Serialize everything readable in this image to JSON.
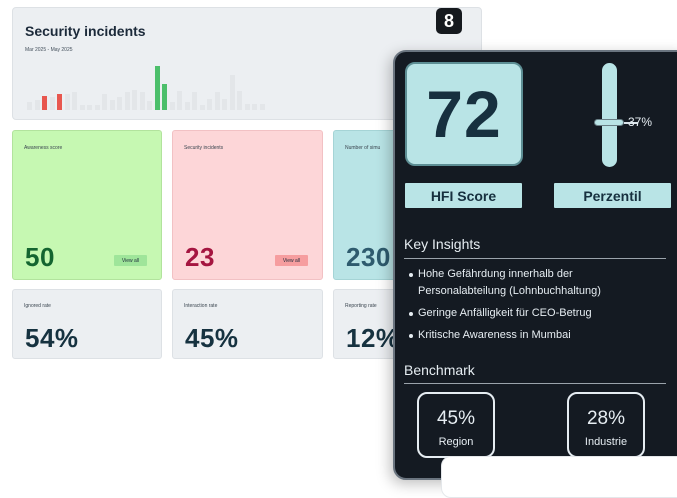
{
  "panel": {
    "title": "Security incidents",
    "range": "Mar 2025 - May 2025",
    "logo": "8",
    "bars": [
      {
        "v": 0.18,
        "c": "#e3e6e9"
      },
      {
        "v": 0.22,
        "c": "#e3e6e9"
      },
      {
        "v": 0.32,
        "c": "#e8574f"
      },
      {
        "v": 0.3,
        "c": "#e3e6e9"
      },
      {
        "v": 0.36,
        "c": "#e8574f"
      },
      {
        "v": 0.36,
        "c": "#e3e6e9"
      },
      {
        "v": 0.4,
        "c": "#e3e6e9"
      },
      {
        "v": 0.12,
        "c": "#e3e6e9"
      },
      {
        "v": 0.12,
        "c": "#e3e6e9"
      },
      {
        "v": 0.12,
        "c": "#e3e6e9"
      },
      {
        "v": 0.36,
        "c": "#e3e6e9"
      },
      {
        "v": 0.22,
        "c": "#e3e6e9"
      },
      {
        "v": 0.3,
        "c": "#e3e6e9"
      },
      {
        "v": 0.42,
        "c": "#e3e6e9"
      },
      {
        "v": 0.46,
        "c": "#e3e6e9"
      },
      {
        "v": 0.42,
        "c": "#e3e6e9"
      },
      {
        "v": 0.2,
        "c": "#e3e6e9"
      },
      {
        "v": 1.0,
        "c": "#4cbf6b"
      },
      {
        "v": 0.58,
        "c": "#4cbf6b"
      },
      {
        "v": 0.18,
        "c": "#e3e6e9"
      },
      {
        "v": 0.44,
        "c": "#e3e6e9"
      },
      {
        "v": 0.18,
        "c": "#e3e6e9"
      },
      {
        "v": 0.4,
        "c": "#e3e6e9"
      },
      {
        "v": 0.12,
        "c": "#e3e6e9"
      },
      {
        "v": 0.26,
        "c": "#e3e6e9"
      },
      {
        "v": 0.42,
        "c": "#e3e6e9"
      },
      {
        "v": 0.26,
        "c": "#e3e6e9"
      },
      {
        "v": 0.8,
        "c": "#e3e6e9"
      },
      {
        "v": 0.44,
        "c": "#e3e6e9"
      },
      {
        "v": 0.14,
        "c": "#e3e6e9"
      },
      {
        "v": 0.14,
        "c": "#e3e6e9"
      },
      {
        "v": 0.14,
        "c": "#e3e6e9"
      }
    ]
  },
  "cards": [
    {
      "label": "Awareness score",
      "value": "50",
      "button": "View all",
      "bg": "#c6f8b2",
      "border": "#b2e39d",
      "value_color": "#146530",
      "btn_bg": "#9fe59a"
    },
    {
      "label": "Security incidents",
      "value": "23",
      "button": "View all",
      "bg": "#fdd6d8",
      "border": "#f2c1c4",
      "value_color": "#a51540",
      "btn_bg": "#f69d9f"
    },
    {
      "label": "Number of simu",
      "value": "230",
      "bg": "#b9e4e6",
      "border": "#a5d4d6",
      "value_color": "#2e5b6e"
    }
  ],
  "rates": [
    {
      "label": "Ignored rate",
      "value": "54%"
    },
    {
      "label": "Interaction rate",
      "value": "45%"
    },
    {
      "label": "Reporting rate",
      "value": "12%"
    }
  ],
  "hfi": {
    "score": "72",
    "score_label": "HFI Score",
    "percentile": "37%",
    "percentile_value": 0.37,
    "percentile_label": "Perzentil"
  },
  "insights": {
    "title": "Key Insights",
    "items": [
      "Hohe Gefährdung innerhalb der Personalabteilung (Lohnbuchhaltung)",
      "Geringe Anfälligkeit für CEO-Betrug",
      "Kritische Awareness in Mumbai"
    ]
  },
  "benchmark": {
    "title": "Benchmark",
    "region_value": "45%",
    "region_label": "Region",
    "industry_value": "28%",
    "industry_label": "Industrie"
  }
}
